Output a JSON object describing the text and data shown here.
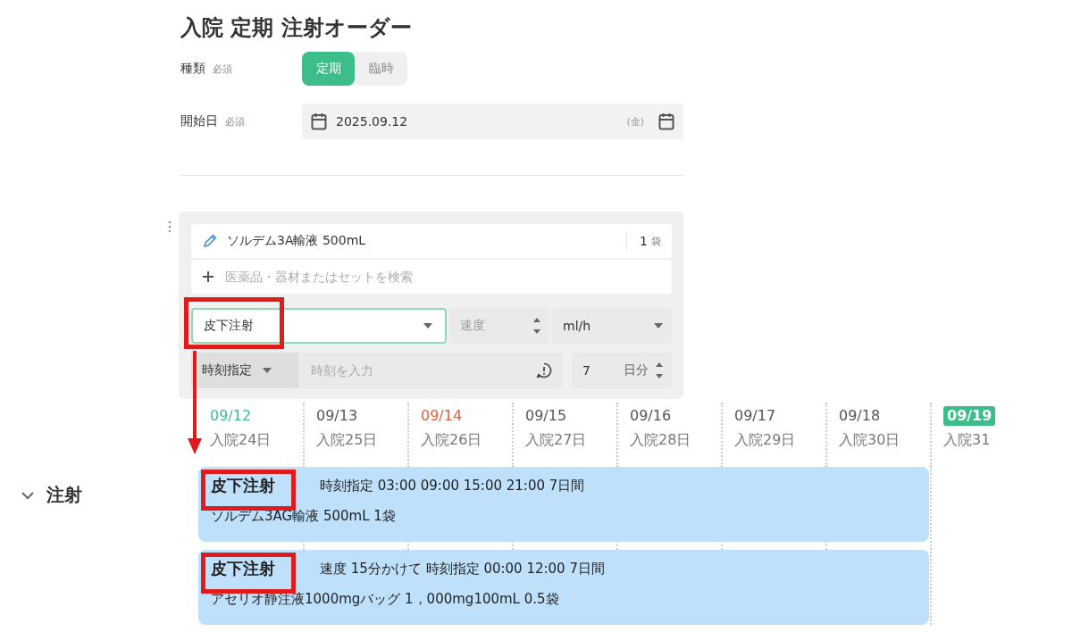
{
  "title": "入院 定期 注射オーダー",
  "type_field": {
    "label": "種類",
    "required": "必須",
    "options": [
      {
        "label": "定期",
        "selected": true
      },
      {
        "label": "臨時",
        "selected": false
      }
    ]
  },
  "start_date": {
    "label": "開始日",
    "required": "必須",
    "value": "2025.09.12",
    "weekday": "(金)"
  },
  "order": {
    "drug": {
      "name": "ソルデム3A輸液 500mL",
      "quantity": "1",
      "unit": "袋"
    },
    "search": {
      "placeholder": "医薬品・器材またはセットを検索"
    },
    "route": {
      "value": "皮下注射"
    },
    "speed": {
      "placeholder": "速度",
      "unit": "ml/h"
    },
    "timing": {
      "mode": "時刻指定",
      "placeholder": "時刻を入力"
    },
    "days": {
      "value": "7",
      "unit": "日分"
    }
  },
  "section": {
    "title": "注射",
    "expanded": true
  },
  "timeline": {
    "dates": [
      {
        "date": "09/12",
        "day": "入院24日",
        "kind": "today"
      },
      {
        "date": "09/13",
        "day": "入院25日",
        "kind": "normal"
      },
      {
        "date": "09/14",
        "day": "入院26日",
        "kind": "holiday"
      },
      {
        "date": "09/15",
        "day": "入院27日",
        "kind": "normal"
      },
      {
        "date": "09/16",
        "day": "入院28日",
        "kind": "normal"
      },
      {
        "date": "09/17",
        "day": "入院29日",
        "kind": "normal"
      },
      {
        "date": "09/18",
        "day": "入院30日",
        "kind": "normal"
      },
      {
        "date": "09/19",
        "day": "入院31",
        "kind": "highlight"
      }
    ],
    "entries": [
      {
        "route": "皮下注射",
        "detail": "時刻指定 03:00 09:00 15:00 21:00 7日間",
        "drug": "ソルデム3AG輸液 500mL 1袋"
      },
      {
        "route": "皮下注射",
        "detail": "速度 15分かけて 時刻指定 00:00 12:00 7日間",
        "drug": "アセリオ静注液1000mgバッグ 1，000mg100mL 0.5袋"
      }
    ]
  }
}
